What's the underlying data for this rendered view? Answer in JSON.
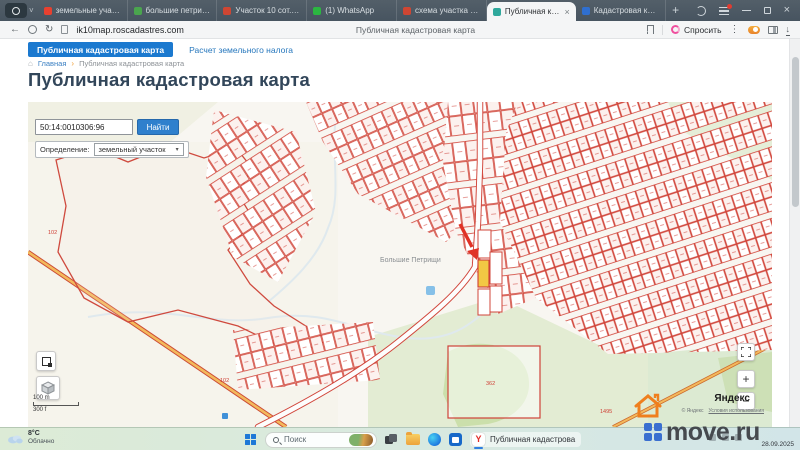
{
  "browser": {
    "tabs": [
      {
        "label": "земельные участки",
        "color": "#e8402f"
      },
      {
        "label": "большие петрищи",
        "color": "#4aa54e"
      },
      {
        "label": "Участок 10 сот. 06",
        "color": "#cf4633"
      },
      {
        "label": "(1) WhatsApp",
        "color": "#2bb741"
      },
      {
        "label": "схема участка по к",
        "color": "#cf4633"
      },
      {
        "label": "Публичная када",
        "color": "#2fa89c"
      },
      {
        "label": "Кадастровая карта",
        "color": "#2f6fd0"
      }
    ],
    "url": "ik10map.roscadastres.com",
    "page_title": "Публичная кадастровая карта",
    "ask_label": "Спросить"
  },
  "site": {
    "nav_primary": "Публичная кадастровая карта",
    "nav_secondary": "Расчет земельного налога",
    "breadcrumb": {
      "home": "Главная",
      "separator": "›",
      "current": "Публичная кадастровая карта"
    },
    "heading": "Публичная кадастровая карта"
  },
  "map": {
    "search": {
      "value": "50:14:0010306:96",
      "button": "Найти"
    },
    "filter": {
      "label": "Определение:",
      "value": "земельный участок"
    },
    "controls": {
      "zoom_in": "+",
      "zoom_out": "−"
    },
    "scale": {
      "metric": "100 m",
      "imperial": "300 f"
    },
    "labels": [
      {
        "text": "102"
      },
      {
        "text": "102"
      },
      {
        "text": "362"
      },
      {
        "text": "1495"
      }
    ],
    "village": "Большие Петрищи",
    "attribution": {
      "logo": "Яндекс",
      "copyright": "© Яндекс",
      "terms": "Условия использования"
    }
  },
  "taskbar": {
    "weather": {
      "temp": "8°C",
      "condition": "Облачно"
    },
    "search_placeholder": "Поиск",
    "active_app": "Публичная кадастрова",
    "date": "28.09.2025"
  },
  "watermark": "move.ru",
  "icons": {
    "back": "←",
    "refresh": "↻",
    "menu_dots": "⋮",
    "download": "↓",
    "close_tab": "×",
    "minimize": "",
    "close_window": "×",
    "new_tab": "+",
    "chevron_down": "˅",
    "breadcrumb_home": "⌂",
    "dropdown_arrow": "▾",
    "yandex_letter": "Y"
  }
}
